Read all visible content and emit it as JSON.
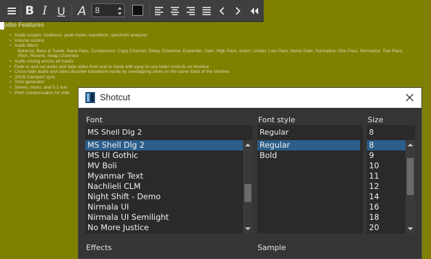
{
  "toolbar": {
    "buttons": [
      {
        "name": "menu",
        "icon": "hamburger-icon"
      },
      {
        "name": "bold",
        "label": "B"
      },
      {
        "name": "italic",
        "label": "I"
      },
      {
        "name": "underline",
        "label": "U"
      },
      {
        "name": "font",
        "label": "A"
      },
      {
        "name": "align-left",
        "icon": "align-left-icon"
      },
      {
        "name": "align-center",
        "icon": "align-center-icon"
      },
      {
        "name": "align-right",
        "icon": "align-right-icon"
      },
      {
        "name": "align-justify",
        "icon": "align-justify-icon"
      },
      {
        "name": "undo",
        "icon": "chevron-left-icon"
      },
      {
        "name": "redo",
        "icon": "chevron-right-icon"
      },
      {
        "name": "rewind",
        "icon": "double-chevron-left-icon"
      }
    ],
    "font_size": "8",
    "text_color": "#111111"
  },
  "document": {
    "heading": "udio Features",
    "items": [
      {
        "text": "Audio scopes: loudness, peak meter, waveform, spectrum analyzer"
      },
      {
        "text": "Volume control"
      },
      {
        "text": "Audio filters:",
        "sub": [
          "Balance, Bass & Treble, Band Pass, Compressor, Copy Channel, Delay, Downmix, Expander, Gain, High Pass, Invert, Limiter, Low Pass, Noise Gate, Normalize: One Pass, Normalize: Two Pass,",
          "Pitch, Reverb, Swap Channels"
        ]
      },
      {
        "text": "Audio mixing across all tracks"
      },
      {
        "text": "Fade in and out audio and fade video from and to black with easy-to-use fader controls on timeline"
      },
      {
        "text": "Cross-fade audio and video dissolve transitions easily by overlapping shots on the same track of the timeline"
      },
      {
        "text": "JACK transport sync"
      },
      {
        "text": "Tone generator"
      },
      {
        "text": "Stereo, mono, and 5.1 surr"
      },
      {
        "text": "Pitch compensation for vide"
      }
    ]
  },
  "dialog": {
    "title": "Shotcut",
    "font": {
      "label": "Font",
      "value": "MS Shell Dlg 2",
      "options": [
        "MS Shell Dlg 2",
        "MS UI Gothic",
        "MV Boli",
        "Myanmar Text",
        "Nachlieli CLM",
        "Night Shift - Demo",
        "Nirmala UI",
        "Nirmala UI Semilight",
        "No More Justice"
      ],
      "selected_index": 0
    },
    "style": {
      "label": "Font style",
      "value": "Regular",
      "options": [
        "Regular",
        "Bold"
      ],
      "selected_index": 0
    },
    "size": {
      "label": "Size",
      "value": "8",
      "options": [
        "8",
        "9",
        "10",
        "11",
        "12",
        "14",
        "16",
        "18",
        "20"
      ],
      "selected_index": 0
    },
    "effects_label": "Effects",
    "sample_label": "Sample"
  },
  "colors": {
    "canvas_bg": "#808000",
    "toolbar_bg": "#3f3f3f",
    "dialog_bg": "#353535",
    "selection": "#2b5e8a"
  }
}
